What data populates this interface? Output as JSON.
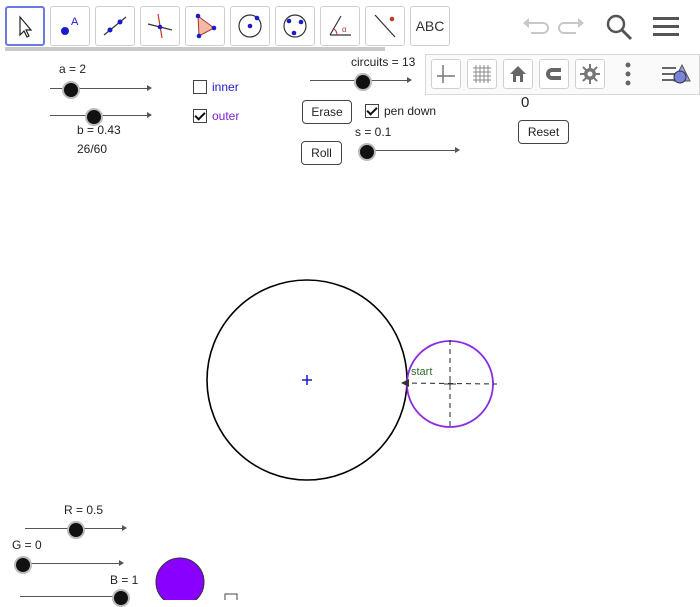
{
  "toolbar": {
    "tools": [
      {
        "name": "move-tool-icon",
        "selected": true
      },
      {
        "name": "point-tool-icon"
      },
      {
        "name": "line-tool-icon"
      },
      {
        "name": "perpendicular-line-tool-icon"
      },
      {
        "name": "polygon-tool-icon"
      },
      {
        "name": "circle-center-point-tool-icon"
      },
      {
        "name": "circle-through-points-tool-icon"
      },
      {
        "name": "angle-tool-icon"
      },
      {
        "name": "reflect-tool-icon"
      },
      {
        "name": "text-tool",
        "label": "ABC"
      }
    ],
    "undo_icon": "undo-icon",
    "redo_icon": "redo-icon",
    "search_icon": "search-icon",
    "menu_icon": "menu-icon"
  },
  "stylebar": {
    "buttons": [
      "axes-icon",
      "grid-icon",
      "home-icon",
      "magnet-icon",
      "gear-icon",
      "more-vert-icon",
      "algebra-view-icon"
    ]
  },
  "controls": {
    "slider_a": {
      "label": "a = 2",
      "value": 2,
      "fraction": 0.2
    },
    "slider_b": {
      "label": "b = 0.43",
      "value": 0.43,
      "fraction": 0.43
    },
    "b_fraction_text": "26/60",
    "inner": {
      "label": "inner",
      "checked": false,
      "color": "#1a1acc"
    },
    "outer": {
      "label": "outer",
      "checked": true,
      "color": "#7a1fd6"
    },
    "slider_circuits": {
      "label": "circuits = 13",
      "value": 13,
      "fraction": 0.5
    },
    "erase_label": "Erase",
    "pen_down": {
      "label": "pen down",
      "checked": true
    },
    "slider_s": {
      "label": "s = 0.1",
      "value": 0.1,
      "fraction": 0.0
    },
    "roll_label": "Roll",
    "counter_value": "0",
    "reset_label": "Reset",
    "slider_R": {
      "label": "R = 0.5",
      "value": 0.5,
      "fraction": 0.5
    },
    "slider_G": {
      "label": "G = 0",
      "value": 0,
      "fraction": 0.0
    },
    "slider_B": {
      "label": "B = 1",
      "value": 1,
      "fraction": 1.0
    }
  },
  "graphics": {
    "start_label": "start",
    "colors": {
      "big_circle": "#000000",
      "small_circle": "#8a2be2",
      "center_point": "#1a1acc",
      "start_text": "#2e6b2e",
      "color_preview": "#8a00ff"
    }
  }
}
